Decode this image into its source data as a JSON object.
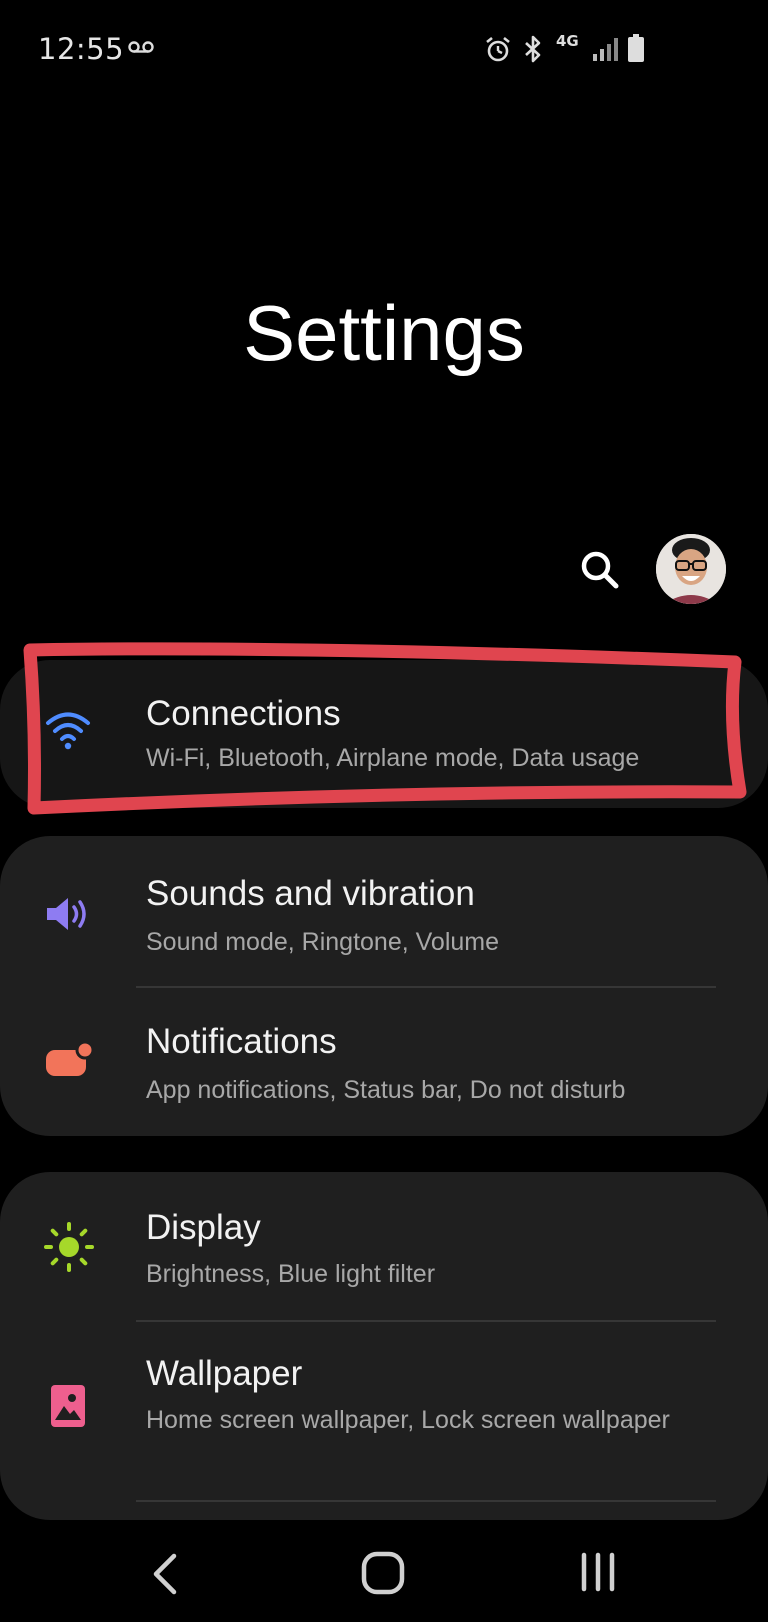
{
  "status_bar": {
    "time": "12:55",
    "network": "4G",
    "icons": [
      "voicemail-icon",
      "alarm-icon",
      "bluetooth-icon",
      "signal-icon",
      "battery-icon"
    ]
  },
  "header": {
    "title": "Settings",
    "search_icon": "search-icon",
    "avatar": "profile-avatar"
  },
  "groups": [
    {
      "items": [
        {
          "title": "Connections",
          "subtitle": "Wi-Fi, Bluetooth, Airplane mode, Data usage",
          "icon": "wifi-icon",
          "icon_color": "#4f8cff",
          "highlighted": true
        }
      ]
    },
    {
      "items": [
        {
          "title": "Sounds and vibration",
          "subtitle": "Sound mode, Ringtone, Volume",
          "icon": "speaker-icon",
          "icon_color": "#8e7cf2"
        },
        {
          "title": "Notifications",
          "subtitle": "App notifications, Status bar, Do not disturb",
          "icon": "notification-icon",
          "icon_color": "#f2745a"
        }
      ]
    },
    {
      "items": [
        {
          "title": "Display",
          "subtitle": "Brightness, Blue light filter",
          "icon": "brightness-icon",
          "icon_color": "#a6d82a"
        },
        {
          "title": "Wallpaper",
          "subtitle": "Home screen wallpaper, Lock screen wallpaper",
          "icon": "wallpaper-icon",
          "icon_color": "#ee5f8e"
        }
      ]
    }
  ],
  "highlight_color": "#e0454f",
  "nav_bar": {
    "icons": [
      "back-icon",
      "home-icon",
      "recents-icon"
    ]
  }
}
